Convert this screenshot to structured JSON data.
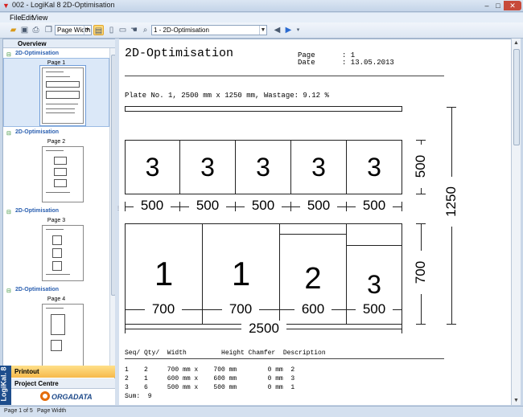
{
  "window": {
    "title": "002 - LogiKal 8 2D-Optimisation"
  },
  "menu": [
    {
      "label": "File"
    },
    {
      "label": "Edit"
    },
    {
      "label": "View"
    }
  ],
  "toolbar": {
    "zoom_mode": "Page Width",
    "page_select": "1 - 2D-Optimisation"
  },
  "sidebar": {
    "header": "Overview",
    "groups": [
      {
        "label": "2D-Optimisation",
        "page": "Page 1"
      },
      {
        "label": "2D-Optimisation",
        "page": "Page 2"
      },
      {
        "label": "2D-Optimisation",
        "page": "Page 3"
      },
      {
        "label": "2D-Optimisation",
        "page": "Page 4"
      }
    ],
    "brand_vertical": "LogiKal. 8",
    "printout": "Printout",
    "project_centre": "Project Centre",
    "logo": "ORGADATA"
  },
  "document": {
    "title": "2D-Optimisation",
    "page_label": "Page",
    "page_value": ": 1",
    "date_label": "Date",
    "date_value": ": 13.05.2013",
    "plate_line": "Plate No. 1, 2500 mm x 1250 mm, Wastage:  9.12 %",
    "row1": {
      "labels": [
        "3",
        "3",
        "3",
        "3",
        "3"
      ],
      "widths": [
        "500",
        "500",
        "500",
        "500",
        "500"
      ],
      "height": "500"
    },
    "row2": {
      "labels": [
        "1",
        "1",
        "2",
        "3"
      ],
      "widths": [
        "700",
        "700",
        "600",
        "500"
      ],
      "height": "700"
    },
    "total_width": "2500",
    "total_height": "1250",
    "table_header": "Seq/ Qty/  Width         Height Chamfer  Description",
    "table_rows": [
      "1    2     700 mm x    700 mm        0 mm  2",
      "2    1     600 mm x    600 mm        0 mm  3",
      "3    6     500 mm x    500 mm        0 mm  1"
    ],
    "sum_line": "Sum:  9"
  },
  "status": {
    "page_of": "Page 1 of 5",
    "zoom": "Page Width"
  }
}
